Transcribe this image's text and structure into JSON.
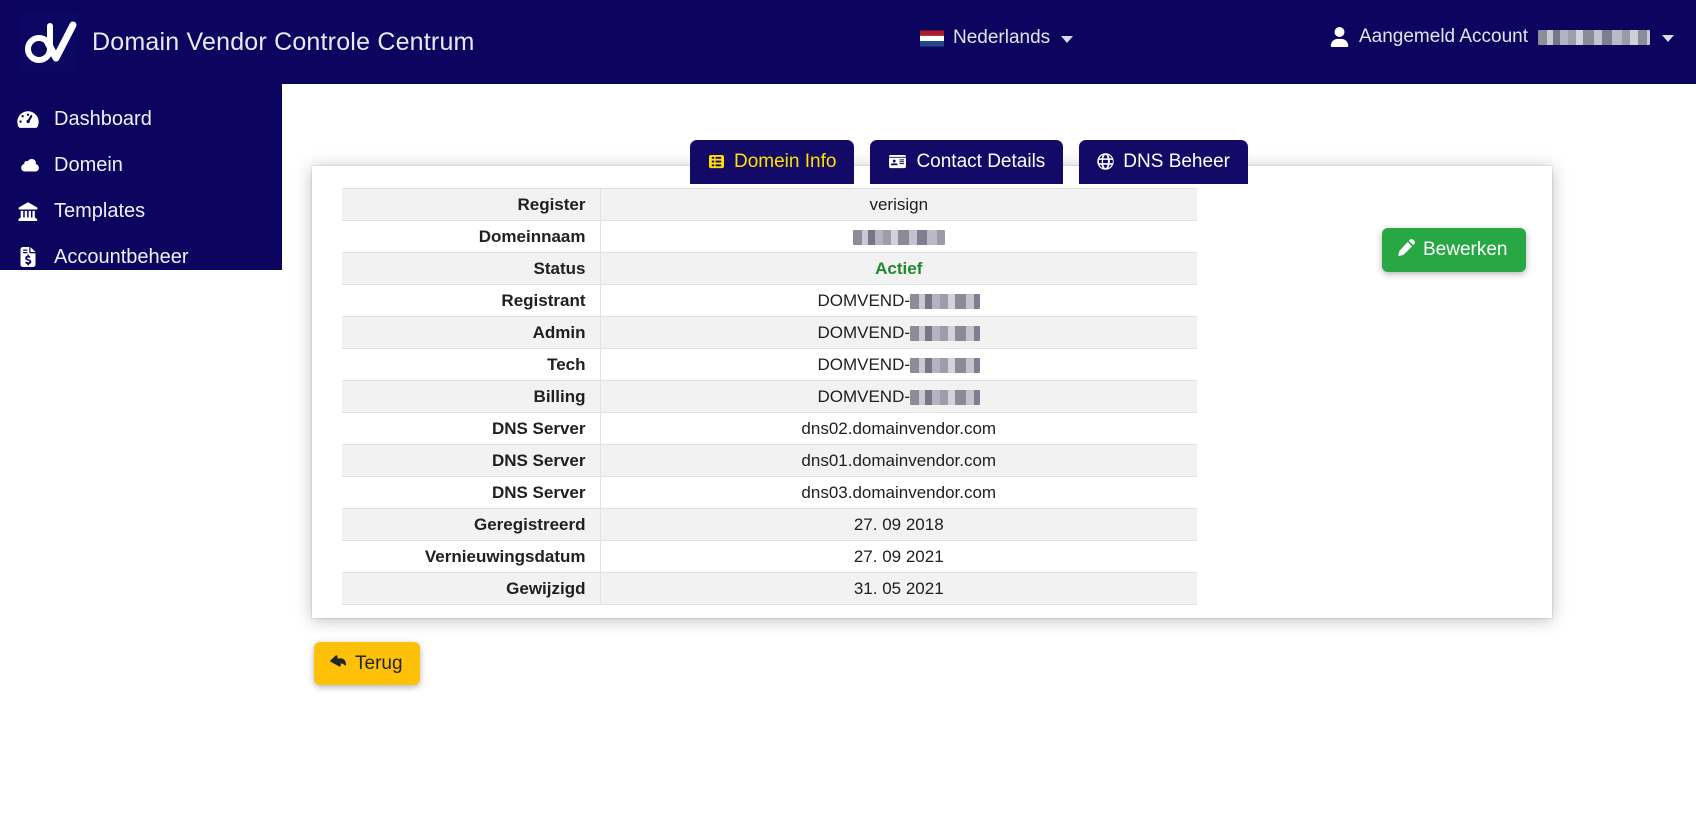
{
  "navbar": {
    "brand_title": "Domain Vendor Controle Centrum",
    "logo_icon": "dv-monogram-logo",
    "language": {
      "label": "Nederlands",
      "flag_icon": "flag-netherlands-icon",
      "caret_icon": "chevron-down-icon"
    },
    "account": {
      "icon": "user-icon",
      "label": "Aangemeld Account",
      "name_redacted": true,
      "caret_icon": "chevron-down-icon"
    }
  },
  "sidebar": {
    "items": [
      {
        "label": "Dashboard",
        "icon": "tachometer-icon"
      },
      {
        "label": "Domein",
        "icon": "cloud-icon"
      },
      {
        "label": "Templates",
        "icon": "building-columns-icon"
      },
      {
        "label": "Accountbeheer",
        "icon": "file-invoice-dollar-icon"
      }
    ]
  },
  "tabs": [
    {
      "label": "Domein Info",
      "icon": "table-list-icon",
      "active": true
    },
    {
      "label": "Contact Details",
      "icon": "id-card-icon",
      "active": false
    },
    {
      "label": "DNS Beheer",
      "icon": "globe-icon",
      "active": false
    }
  ],
  "table": {
    "rows": [
      {
        "label": "Register",
        "value": "verisign",
        "type": "text"
      },
      {
        "label": "Domeinnaam",
        "value": "",
        "type": "redacted-domain"
      },
      {
        "label": "Status",
        "value": "Actief",
        "type": "status-active"
      },
      {
        "label": "Registrant",
        "value": "DOMVEND-",
        "type": "redacted-handle"
      },
      {
        "label": "Admin",
        "value": "DOMVEND-",
        "type": "redacted-handle"
      },
      {
        "label": "Tech",
        "value": "DOMVEND-",
        "type": "redacted-handle"
      },
      {
        "label": "Billing",
        "value": "DOMVEND-",
        "type": "redacted-handle"
      },
      {
        "label": "DNS Server",
        "value": "dns02.domainvendor.com",
        "type": "text"
      },
      {
        "label": "DNS Server",
        "value": "dns01.domainvendor.com",
        "type": "text"
      },
      {
        "label": "DNS Server",
        "value": "dns03.domainvendor.com",
        "type": "text"
      },
      {
        "label": "Geregistreerd",
        "value": "27. 09 2018",
        "type": "text"
      },
      {
        "label": "Vernieuwingsdatum",
        "value": "27. 09 2021",
        "type": "text"
      },
      {
        "label": "Gewijzigd",
        "value": "31. 05 2021",
        "type": "text"
      }
    ]
  },
  "buttons": {
    "edit": {
      "label": "Bewerken",
      "icon": "pencil-icon",
      "color": "#28a745"
    },
    "back": {
      "label": "Terug",
      "icon": "reply-icon",
      "color": "#ffc107"
    }
  },
  "colors": {
    "navy": "#0b0560",
    "tab_navy": "#120a66",
    "active_tab_text": "#ffe000",
    "status_green": "#1e8a28",
    "row_stripe": "#f2f2f2"
  }
}
